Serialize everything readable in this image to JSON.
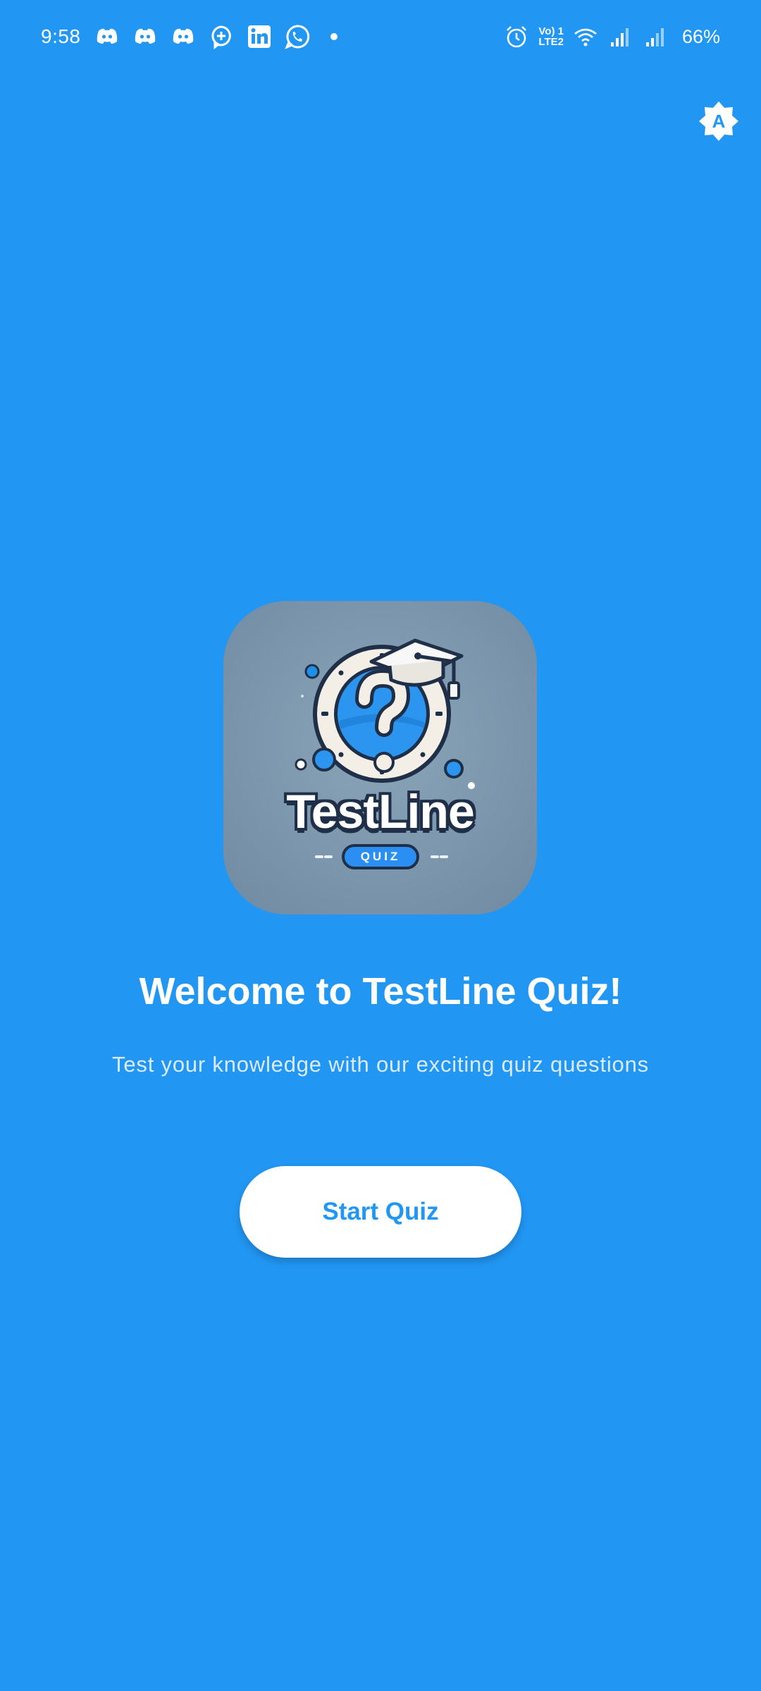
{
  "status_bar": {
    "time": "9:58",
    "notification_icons": [
      "discord-icon",
      "discord-icon",
      "discord-icon",
      "chat-plus-icon",
      "linkedin-icon",
      "whatsapp-icon"
    ],
    "network_label_top": "Vo) 1",
    "network_label_bottom": "LTE2",
    "battery": "66%"
  },
  "theme_toggle": {
    "letter": "A",
    "icon": "brightness-auto-icon"
  },
  "logo": {
    "title": "TestLine",
    "badge": "QUIZ",
    "icon": "question-mark-graduation-cap-icon"
  },
  "welcome": {
    "title": "Welcome to TestLine Quiz!",
    "subtitle": "Test your knowledge with our exciting quiz questions"
  },
  "start_button": {
    "label": "Start Quiz"
  },
  "colors": {
    "background": "#2196F3",
    "button_bg": "#FFFFFF",
    "button_text": "#2196F3"
  }
}
